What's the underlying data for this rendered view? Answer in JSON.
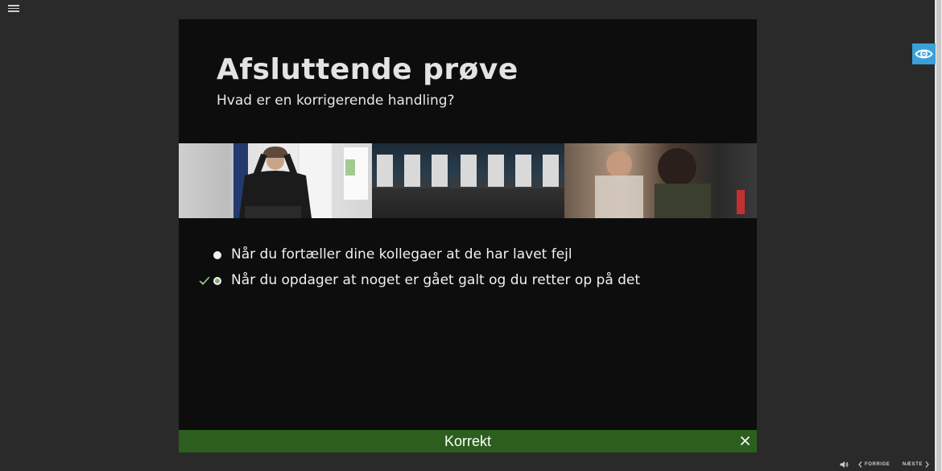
{
  "slide": {
    "title": "Afsluttende prøve",
    "question": "Hvad er en korrigerende handling?",
    "options": [
      {
        "label": "Når du fortæller dine kollegaer at de har lavet fejl",
        "selected": false,
        "correct_mark": false
      },
      {
        "label": "Når du opdager at noget er gået galt og du retter op på det",
        "selected": true,
        "correct_mark": true
      }
    ]
  },
  "feedback": {
    "text": "Korrekt",
    "color": "#2c5f1e"
  },
  "navigation": {
    "prev_label": "FORRIGE",
    "next_label": "NÆSTE"
  },
  "icons": {
    "menu": "hamburger-menu-icon",
    "eye": "eye-icon",
    "check": "checkmark-icon",
    "close": "close-icon",
    "audio": "speaker-icon",
    "prev": "chevron-left-icon",
    "next": "chevron-right-icon"
  },
  "colors": {
    "accent": "#3aa0d8",
    "check": "#7fb06a"
  }
}
